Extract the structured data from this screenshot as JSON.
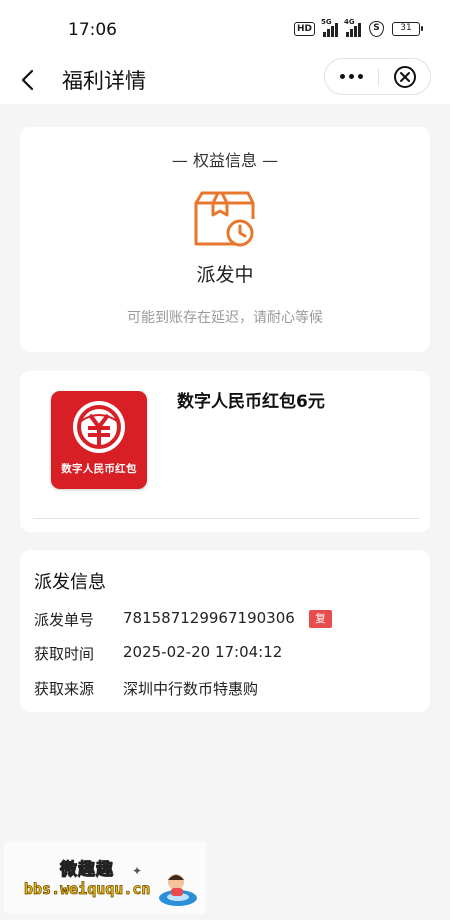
{
  "status_bar": {
    "time": "17:06",
    "hd_label": "HD",
    "signal_1_label": "5G",
    "signal_2_label": "4G",
    "shield_label": "S",
    "battery_level": "31"
  },
  "nav": {
    "title": "福利详情",
    "back_icon": "chevron-left-icon",
    "more_icon": "more-dots-icon",
    "close_icon": "close-circle-icon"
  },
  "benefit": {
    "header": "— 权益信息 —",
    "status_icon": "package-clock-icon",
    "status": "派发中",
    "hint": "可能到账存在延迟，请耐心等候"
  },
  "product": {
    "image_label": "数字人民币红包",
    "title": "数字人民币红包6元"
  },
  "dispatch": {
    "title": "派发信息",
    "rows": [
      {
        "label": "派发单号",
        "value": "781587129967190306"
      },
      {
        "label": "获取时间",
        "value": "2025-02-20 17:04:12"
      },
      {
        "label": "获取来源",
        "value": "深圳中行数币特惠购"
      }
    ],
    "copy_label": "复制"
  },
  "watermark": {
    "title": "微趣趣",
    "url": "bbs.weiququ.cn"
  },
  "colors": {
    "accent_orange": "#e8772e",
    "brand_red": "#d81f26",
    "copy_red": "#e84c4c"
  }
}
